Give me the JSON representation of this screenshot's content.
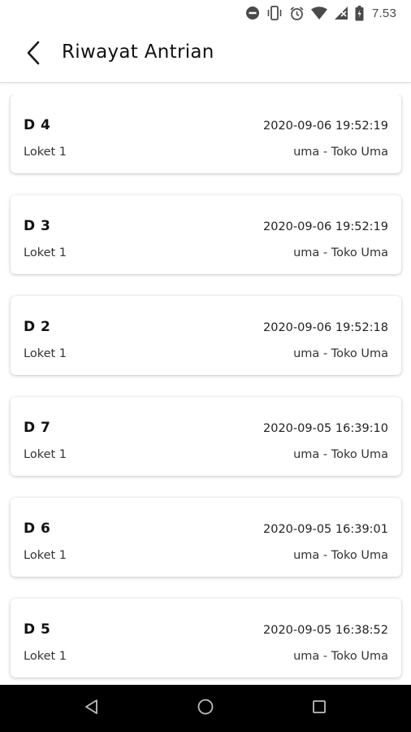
{
  "status_bar": {
    "time": "7.53",
    "icons": [
      "do-not-disturb-icon",
      "vibrate-icon",
      "alarm-icon",
      "wifi-icon",
      "signal-icon",
      "battery-icon"
    ]
  },
  "app_bar": {
    "back_icon": "arrow-back-icon",
    "title": "Riwayat Antrian"
  },
  "queue_history": [
    {
      "code": "D 4",
      "datetime": "2020-09-06 19:52:19",
      "counter": "Loket 1",
      "store": "uma - Toko Uma"
    },
    {
      "code": "D 3",
      "datetime": "2020-09-06 19:52:19",
      "counter": "Loket 1",
      "store": "uma - Toko Uma"
    },
    {
      "code": "D 2",
      "datetime": "2020-09-06 19:52:18",
      "counter": "Loket 1",
      "store": "uma - Toko Uma"
    },
    {
      "code": "D 7",
      "datetime": "2020-09-05 16:39:10",
      "counter": "Loket 1",
      "store": "uma - Toko Uma"
    },
    {
      "code": "D 6",
      "datetime": "2020-09-05 16:39:01",
      "counter": "Loket 1",
      "store": "uma - Toko Uma"
    },
    {
      "code": "D 5",
      "datetime": "2020-09-05 16:38:52",
      "counter": "Loket 1",
      "store": "uma - Toko Uma"
    }
  ],
  "nav_bar": {
    "icons": [
      "back-triangle-icon",
      "home-circle-icon",
      "recents-square-icon"
    ]
  },
  "colors": {
    "background": "#ffffff",
    "text_primary": "#111111",
    "divider": "#dedede",
    "nav_bar": "#000000"
  }
}
